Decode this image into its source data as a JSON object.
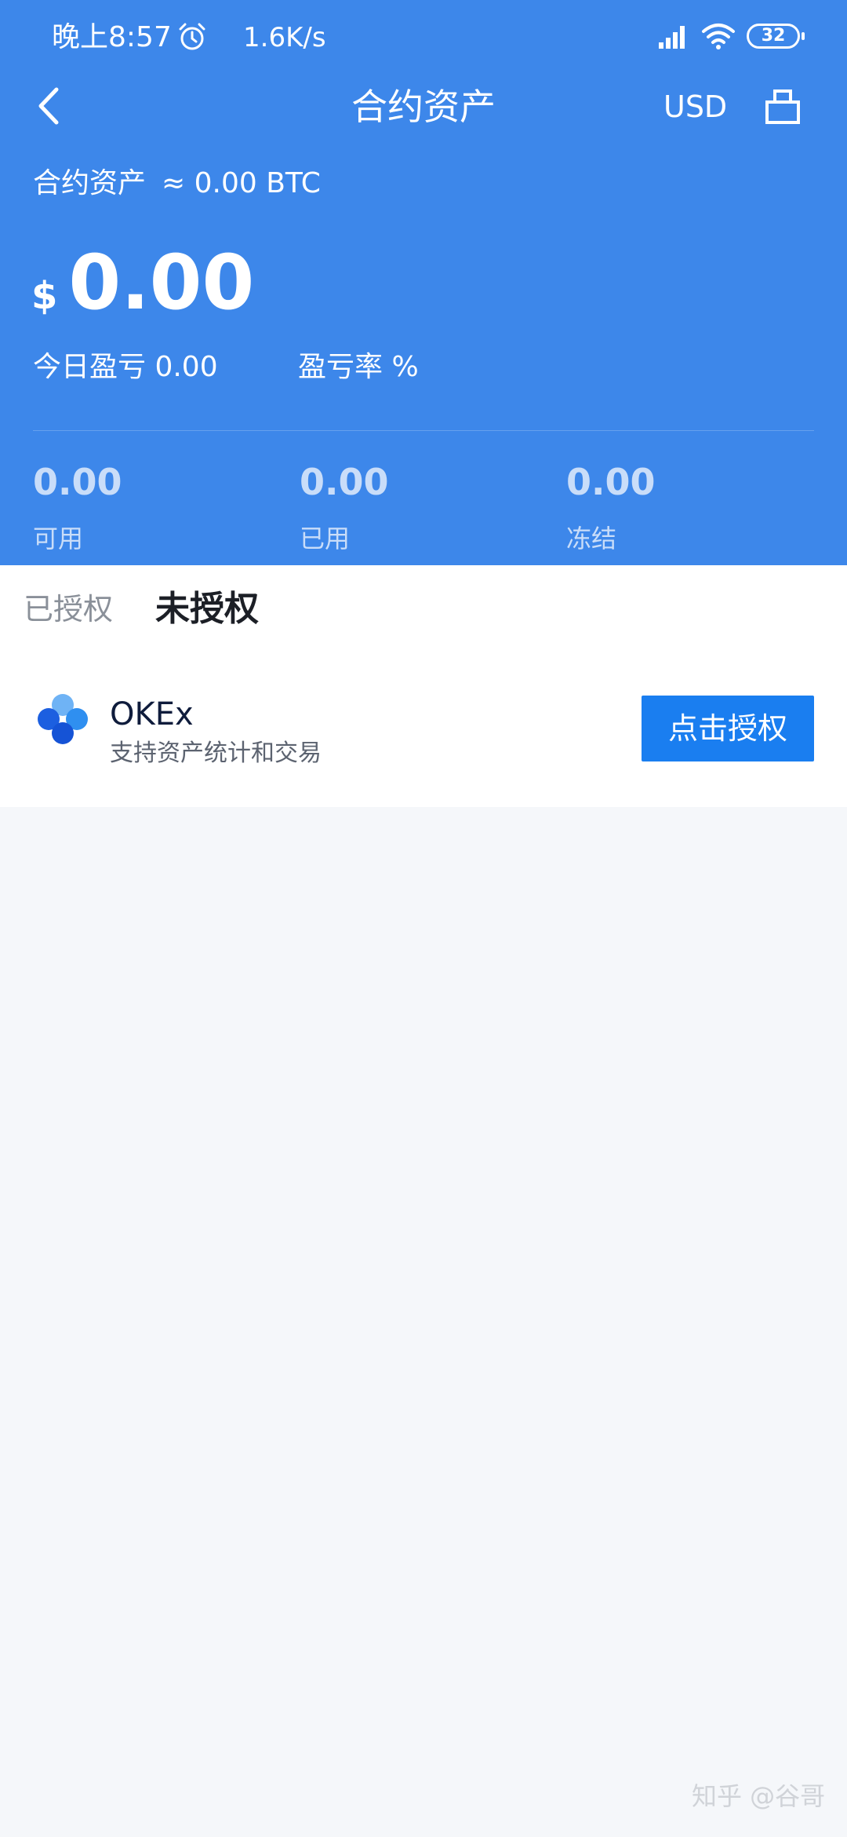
{
  "status_bar": {
    "time": "晚上8:57",
    "net_speed": "1.6K/s",
    "battery": "32"
  },
  "nav": {
    "title": "合约资产",
    "currency": "USD"
  },
  "summary": {
    "label": "合约资产",
    "btc_value": "≈ 0.00 BTC",
    "currency_symbol": "$",
    "balance": "0.00",
    "pnl_label": "今日盈亏 0.00",
    "pnl_rate_label": "盈亏率 %",
    "stats": [
      {
        "value": "0.00",
        "label": "可用"
      },
      {
        "value": "0.00",
        "label": "已用"
      },
      {
        "value": "0.00",
        "label": "冻结"
      }
    ]
  },
  "tabs": [
    {
      "label": "已授权"
    },
    {
      "label": "未授权",
      "active": true
    }
  ],
  "exchange": {
    "name": "OKEx",
    "description": "支持资产统计和交易",
    "action_label": "点击授权"
  },
  "watermark": "知乎 @谷哥",
  "colors": {
    "header_bg": "#3d87ea",
    "button_bg": "#1a7ef0",
    "page_bg": "#f5f7fa"
  }
}
